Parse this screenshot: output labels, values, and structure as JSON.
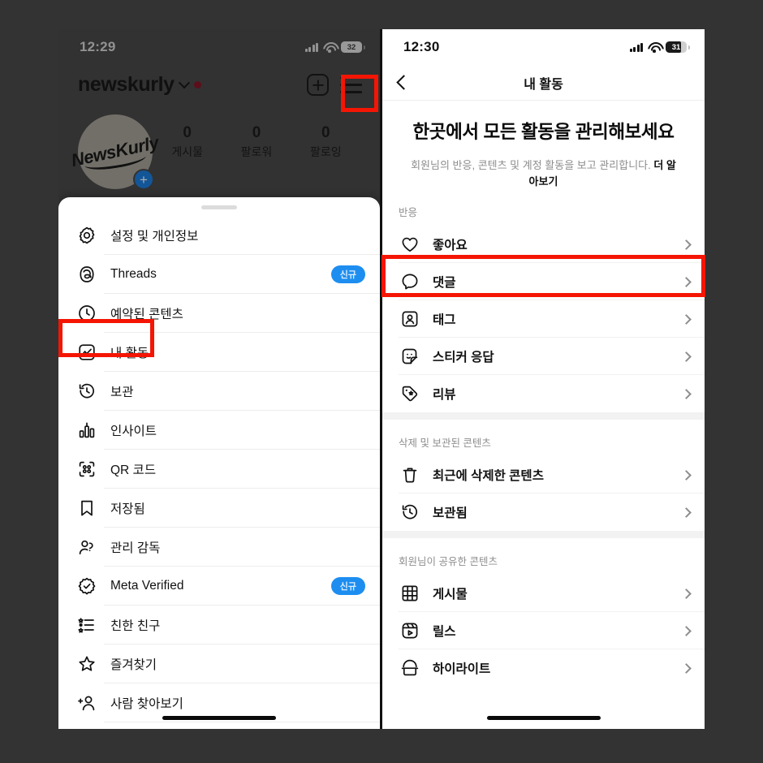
{
  "left_phone": {
    "status": {
      "time": "12:29",
      "battery": "32",
      "signal_icon": "cellular-signal-icon",
      "wifi_icon": "wifi-icon",
      "battery_icon": "battery-icon"
    },
    "profile": {
      "username": "newskurly",
      "dropdown_icon": "chevron-down-icon",
      "unread_dot": "unread-dot",
      "create_icon": "new-post-icon",
      "menu_icon": "hamburger-menu-icon",
      "avatar_text": "NewsKurly",
      "avatar_add_icon": "add-story-icon",
      "handle": "newskurly",
      "stats": [
        {
          "value": "0",
          "label": "게시물"
        },
        {
          "value": "0",
          "label": "팔로워"
        },
        {
          "value": "0",
          "label": "팔로잉"
        }
      ]
    },
    "sheet": {
      "grabber": "drag-handle",
      "items": [
        {
          "label": "설정 및 개인정보",
          "icon": "gear-icon",
          "badge": ""
        },
        {
          "label": "Threads",
          "icon": "threads-icon",
          "badge": "신규"
        },
        {
          "label": "예약된 콘텐츠",
          "icon": "clock-icon",
          "badge": ""
        },
        {
          "label": "내 활동",
          "icon": "activity-chart-icon",
          "badge": ""
        },
        {
          "label": "보관",
          "icon": "archive-history-icon",
          "badge": ""
        },
        {
          "label": "인사이트",
          "icon": "bar-chart-icon",
          "badge": ""
        },
        {
          "label": "QR 코드",
          "icon": "qr-code-icon",
          "badge": ""
        },
        {
          "label": "저장됨",
          "icon": "bookmark-icon",
          "badge": ""
        },
        {
          "label": "관리 감독",
          "icon": "supervision-icon",
          "badge": ""
        },
        {
          "label": "Meta Verified",
          "icon": "verified-badge-icon",
          "badge": "신규"
        },
        {
          "label": "친한 친구",
          "icon": "close-friends-icon",
          "badge": ""
        },
        {
          "label": "즐겨찾기",
          "icon": "star-icon",
          "badge": ""
        },
        {
          "label": "사람 찾아보기",
          "icon": "discover-people-icon",
          "badge": ""
        }
      ]
    }
  },
  "right_phone": {
    "status": {
      "time": "12:30",
      "battery": "31",
      "signal_icon": "cellular-signal-icon",
      "wifi_icon": "wifi-icon",
      "battery_icon": "battery-icon"
    },
    "navbar": {
      "back_icon": "back-chevron-icon",
      "title": "내 활동"
    },
    "hero": {
      "heading": "한곳에서 모든 활동을 관리해보세요",
      "description": "회원님의 반응, 콘텐츠 및 계정 활동을 보고 관리합니다. ",
      "learn_more": "더 알아보기"
    },
    "sections": [
      {
        "title": "반응",
        "items": [
          {
            "label": "좋아요",
            "icon": "heart-icon"
          },
          {
            "label": "댓글",
            "icon": "comment-bubble-icon"
          },
          {
            "label": "태그",
            "icon": "tag-person-icon"
          },
          {
            "label": "스티커 응답",
            "icon": "sticker-icon"
          },
          {
            "label": "리뷰",
            "icon": "review-tag-icon"
          }
        ]
      },
      {
        "title": "삭제 및 보관된 콘텐츠",
        "items": [
          {
            "label": "최근에 삭제한 콘텐츠",
            "icon": "trash-icon"
          },
          {
            "label": "보관됨",
            "icon": "archive-history-icon"
          }
        ]
      },
      {
        "title": "회원님이 공유한 콘텐츠",
        "items": [
          {
            "label": "게시물",
            "icon": "grid-icon"
          },
          {
            "label": "릴스",
            "icon": "reels-icon"
          },
          {
            "label": "하이라이트",
            "icon": "highlights-icon"
          }
        ]
      }
    ],
    "chevron_icon": "chevron-right-icon"
  },
  "annotations": {
    "highlight_color": "#f51505",
    "boxes": [
      {
        "name": "hamburger-menu-highlight"
      },
      {
        "name": "my-activity-highlight"
      },
      {
        "name": "likes-highlight"
      }
    ]
  }
}
